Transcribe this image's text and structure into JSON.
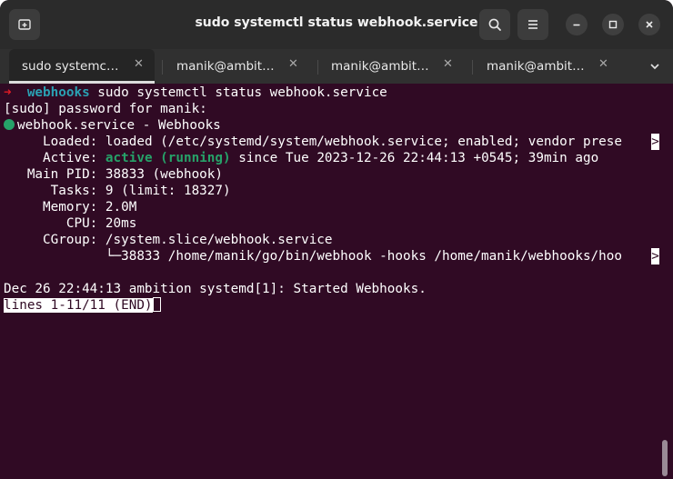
{
  "window": {
    "title": "sudo systemctl status webhook.service"
  },
  "tabs": [
    {
      "label": "sudo systemc…",
      "active": true
    },
    {
      "label": "manik@ambit…",
      "active": false
    },
    {
      "label": "manik@ambit…",
      "active": false
    },
    {
      "label": "manik@ambit…",
      "active": false
    }
  ],
  "terminal": {
    "prompt_arrow": "➜",
    "prompt_dir": "webhooks",
    "command": " sudo systemctl status webhook.service",
    "sudo_prompt": "[sudo] password for manik:",
    "service_header": "webhook.service - Webhooks",
    "loaded_key": "     Loaded:",
    "loaded_value": " loaded (/etc/systemd/system/webhook.service; enabled; vendor prese",
    "active_key": "     Active:",
    "active_state": "active (running)",
    "active_since": " since Tue 2023-12-26 22:44:13 +0545; 39min ago",
    "main_pid": "   Main PID: 38833 (webhook)",
    "tasks": "      Tasks: 9 (limit: 18327)",
    "memory": "     Memory: 2.0M",
    "cpu": "        CPU: 20ms",
    "cgroup": "     CGroup: /system.slice/webhook.service",
    "cgroup_child": "             └─38833 /home/manik/go/bin/webhook -hooks /home/manik/webhooks/hoo",
    "truncate_marker": ">",
    "log_line": "Dec 26 22:44:13 ambition systemd[1]: Started Webhooks.",
    "pager_status": "lines 1-11/11 (END)"
  },
  "colors": {
    "terminal_bg": "#300a24",
    "active_green": "#26a269",
    "prompt_red": "#e01b24",
    "prompt_cyan": "#2aa1b3"
  }
}
